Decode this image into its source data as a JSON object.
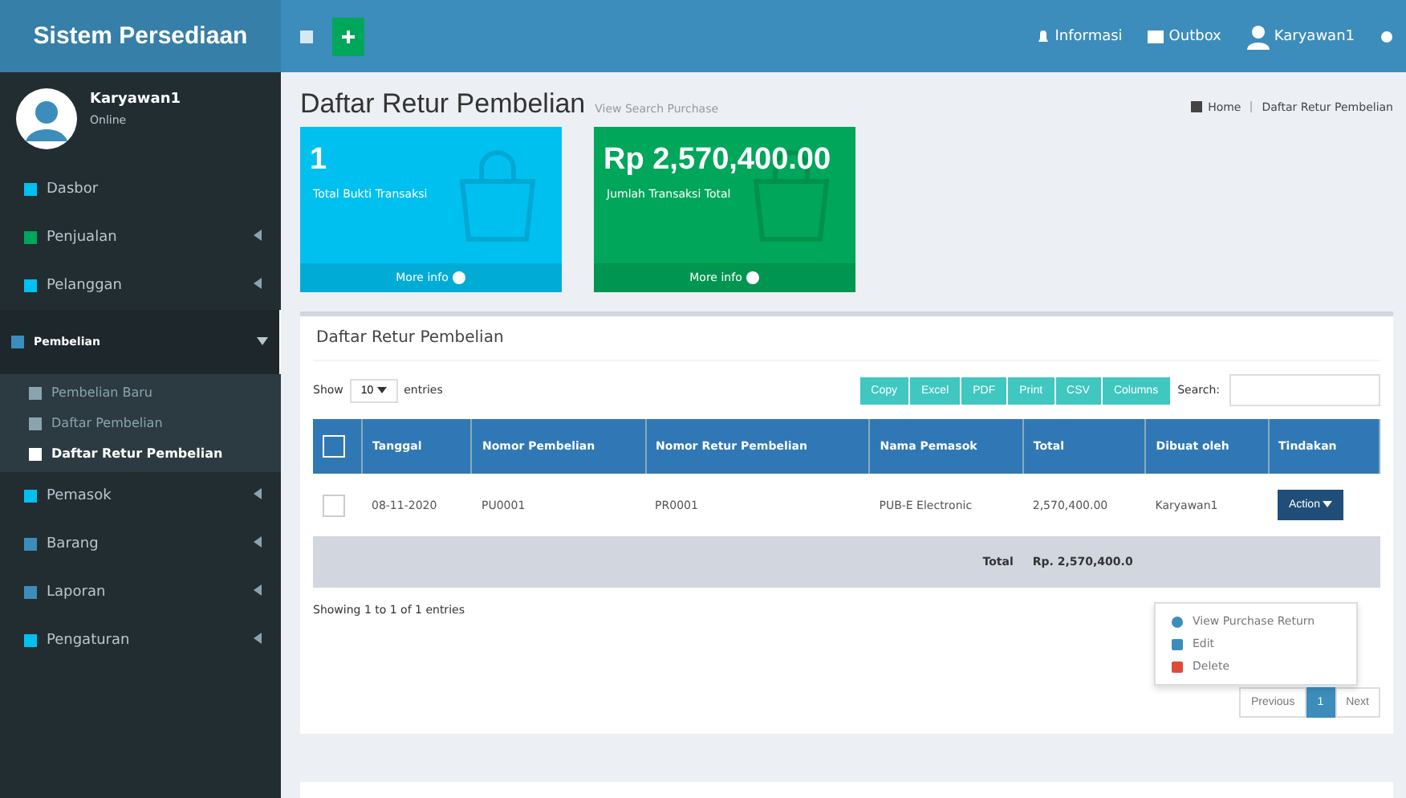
{
  "brand": "Sistem Persediaan",
  "topnav": [
    {
      "kind": "bell",
      "label": "Informasi"
    },
    {
      "kind": "mail",
      "label": "Outbox"
    },
    {
      "kind": "user",
      "label": "Karyawan1"
    }
  ],
  "user": {
    "name": "Karyawan1",
    "status": "Online"
  },
  "sidebar": [
    {
      "label": "Dasbor",
      "color": "#00c0ef",
      "has_children": false,
      "expanded": false
    },
    {
      "label": "Penjualan",
      "color": "#00a65a",
      "has_children": true,
      "expanded": false
    },
    {
      "label": "Pelanggan",
      "color": "#00c0ef",
      "has_children": true,
      "expanded": false
    },
    {
      "label": "Pembelian",
      "color": "#3c8dbc",
      "has_children": true,
      "expanded": true,
      "children": [
        {
          "label": "Pembelian Baru",
          "selected": false
        },
        {
          "label": "Daftar Pembelian",
          "selected": false
        },
        {
          "label": "Daftar Retur Pembelian",
          "selected": true
        }
      ]
    },
    {
      "label": "Pemasok",
      "color": "#00c0ef",
      "has_children": true,
      "expanded": false
    },
    {
      "label": "Barang",
      "color": "#3c8dbc",
      "has_children": true,
      "expanded": false
    },
    {
      "label": "Laporan",
      "color": "#3c8dbc",
      "has_children": true,
      "expanded": false
    },
    {
      "label": "Pengaturan",
      "color": "#00c0ef",
      "has_children": true,
      "expanded": false
    }
  ],
  "page": {
    "title": "Daftar Retur Pembelian",
    "subtitle": "View Search Purchase",
    "breadcrumb": [
      "Home",
      "Daftar Retur Pembelian"
    ]
  },
  "stats": [
    {
      "value": "1",
      "label": "Total Bukti Transaksi",
      "link": "More info",
      "color": "#00c0ef"
    },
    {
      "value": "Rp 2,570,400.00",
      "label": "Jumlah Transaksi Total",
      "link": "More info",
      "color": "#00a65a"
    }
  ],
  "card": {
    "title": "Daftar Retur Pembelian",
    "show_label": "Show",
    "page_size": "10",
    "entries_label": "entries",
    "export_buttons": [
      "Copy",
      "Excel",
      "PDF",
      "Print",
      "CSV",
      "Columns"
    ],
    "search_label": "Search:",
    "select_all_checked": false,
    "columns": [
      "Tanggal",
      "Nomor Pembelian",
      "Nomor Retur Pembelian",
      "Nama Pemasok",
      "Total",
      "Dibuat oleh",
      "Tindakan"
    ],
    "rows": [
      {
        "checked": false,
        "cells": [
          "08-11-2020",
          "PU0001",
          "PR0001",
          "PUB-E Electronic",
          "2,570,400.00",
          "Karyawan1"
        ],
        "action": "Action"
      }
    ],
    "footer_label": "Total",
    "footer_value": "Rp. 2,570,400.0",
    "menu": [
      {
        "kind": "view",
        "label": "View Purchase Return"
      },
      {
        "kind": "edit",
        "label": "Edit"
      },
      {
        "kind": "delete",
        "label": "Delete"
      }
    ],
    "info": "Showing 1 to 1 of 1 entries",
    "pagination": [
      {
        "label": "Previous",
        "selected": false
      },
      {
        "label": "1",
        "selected": true
      },
      {
        "label": "Next",
        "selected": false
      }
    ]
  }
}
